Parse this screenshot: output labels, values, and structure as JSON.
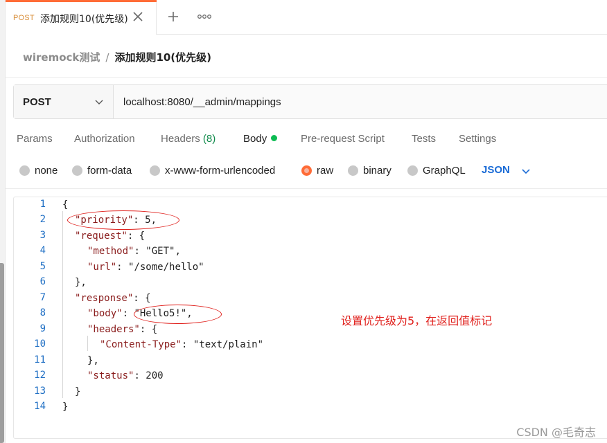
{
  "tab": {
    "method": "POST",
    "title": "添加规则10(优先级)"
  },
  "breadcrumb": {
    "parent": "wiremock测试",
    "separator": "/",
    "current": "添加规则10(优先级)"
  },
  "request": {
    "method": "POST",
    "url": "localhost:8080/__admin/mappings"
  },
  "request_tabs": [
    {
      "label": "Params"
    },
    {
      "label": "Authorization"
    },
    {
      "label": "Headers",
      "count": "(8)"
    },
    {
      "label": "Body"
    },
    {
      "label": "Pre-request Script"
    },
    {
      "label": "Tests"
    },
    {
      "label": "Settings"
    }
  ],
  "body_modes": {
    "options": [
      "none",
      "form-data",
      "x-www-form-urlencoded",
      "raw",
      "binary",
      "GraphQL"
    ],
    "selected": "raw",
    "format": "JSON"
  },
  "editor": {
    "line_numbers": [
      "1",
      "2",
      "3",
      "4",
      "5",
      "6",
      "7",
      "8",
      "9",
      "10",
      "11",
      "12",
      "13",
      "14"
    ],
    "lines": [
      "{",
      "\"priority\": 5,",
      "\"request\": {",
      "\"method\": \"GET\",",
      "\"url\": \"/some/hello\"",
      "},",
      "\"response\": {",
      "\"body\": \"Hello5!\",",
      "\"headers\": {",
      "\"Content-Type\": \"text/plain\"",
      "},",
      "\"status\": 200",
      "}",
      "}"
    ]
  },
  "annotation": "设置优先级为5，在返回值标记",
  "watermark": "CSDN @毛奇志",
  "colors": {
    "accent": "#ff6c37",
    "active_dot": "#0cbb52",
    "annotation": "#e0201c",
    "json_select": "#1a6bd6"
  },
  "icons": {
    "close": "close-icon",
    "add": "plus-icon",
    "more": "more-horizontal-icon",
    "dropdown": "chevron-down-icon"
  }
}
